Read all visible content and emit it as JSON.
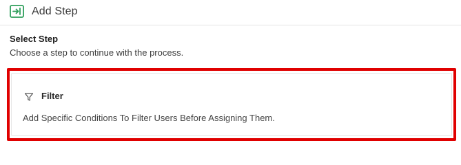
{
  "header": {
    "icon": "step-enter-icon",
    "title": "Add Step",
    "accent_color": "#2e9e5b"
  },
  "section": {
    "title": "Select Step",
    "description": "Choose a step to continue with the process."
  },
  "steps": [
    {
      "icon": "filter-icon",
      "title": "Filter",
      "description": "Add Specific Conditions To Filter Users Before Assigning Them."
    }
  ],
  "highlight_color": "#e00000"
}
